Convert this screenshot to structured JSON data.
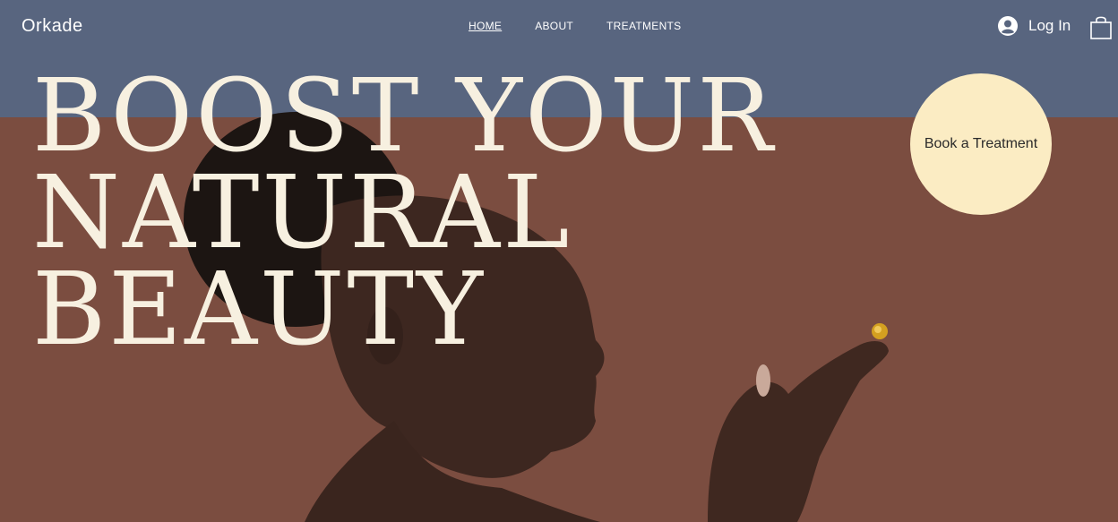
{
  "brand": {
    "name": "Orkade"
  },
  "nav": {
    "items": [
      {
        "label": "HOME"
      },
      {
        "label": "ABOUT"
      },
      {
        "label": "TREATMENTS"
      }
    ]
  },
  "account": {
    "login_label": "Log In"
  },
  "hero": {
    "headline_lines": [
      "BOOST YOUR",
      "NATURAL",
      "BEAUTY"
    ],
    "cta_label": "Book a Treatment"
  },
  "colors": {
    "top_band": "#58657f",
    "background": "#7b4d40",
    "headline": "#f7f0e0",
    "cta_bg": "#fbecc3"
  },
  "icons": {
    "user": "user-icon",
    "cart": "shopping-bag-icon"
  }
}
